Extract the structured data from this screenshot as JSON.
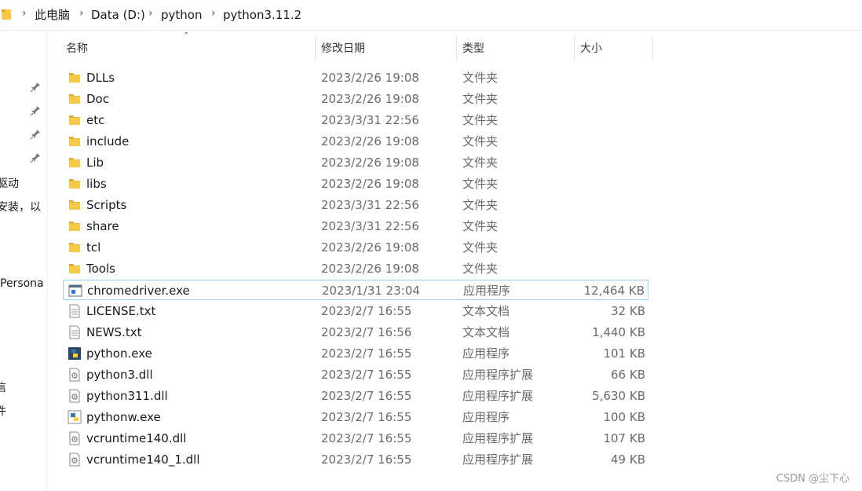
{
  "breadcrumb": {
    "parts": [
      "此电脑",
      "Data (D:)",
      "python",
      "python3.11.2"
    ],
    "separator": ">"
  },
  "nav_fragments": [
    "驱动",
    "安装，以",
    "Persona",
    "信",
    "件"
  ],
  "columns": {
    "name": "名称",
    "date": "修改日期",
    "type": "类型",
    "size": "大小"
  },
  "files": [
    {
      "name": "DLLs",
      "date": "2023/2/26 19:08",
      "type": "文件夹",
      "size": "",
      "icon": "folder-icon"
    },
    {
      "name": "Doc",
      "date": "2023/2/26 19:08",
      "type": "文件夹",
      "size": "",
      "icon": "folder-icon"
    },
    {
      "name": "etc",
      "date": "2023/3/31 22:56",
      "type": "文件夹",
      "size": "",
      "icon": "folder-icon"
    },
    {
      "name": "include",
      "date": "2023/2/26 19:08",
      "type": "文件夹",
      "size": "",
      "icon": "folder-icon"
    },
    {
      "name": "Lib",
      "date": "2023/2/26 19:08",
      "type": "文件夹",
      "size": "",
      "icon": "folder-icon"
    },
    {
      "name": "libs",
      "date": "2023/2/26 19:08",
      "type": "文件夹",
      "size": "",
      "icon": "folder-icon"
    },
    {
      "name": "Scripts",
      "date": "2023/3/31 22:56",
      "type": "文件夹",
      "size": "",
      "icon": "folder-icon"
    },
    {
      "name": "share",
      "date": "2023/3/31 22:56",
      "type": "文件夹",
      "size": "",
      "icon": "folder-icon"
    },
    {
      "name": "tcl",
      "date": "2023/2/26 19:08",
      "type": "文件夹",
      "size": "",
      "icon": "folder-icon"
    },
    {
      "name": "Tools",
      "date": "2023/2/26 19:08",
      "type": "文件夹",
      "size": "",
      "icon": "folder-icon"
    },
    {
      "name": "chromedriver.exe",
      "date": "2023/1/31 23:04",
      "type": "应用程序",
      "size": "12,464 KB",
      "icon": "exe-icon",
      "selected": true
    },
    {
      "name": "LICENSE.txt",
      "date": "2023/2/7 16:55",
      "type": "文本文档",
      "size": "32 KB",
      "icon": "text-file-icon"
    },
    {
      "name": "NEWS.txt",
      "date": "2023/2/7 16:56",
      "type": "文本文档",
      "size": "1,440 KB",
      "icon": "text-file-icon"
    },
    {
      "name": "python.exe",
      "date": "2023/2/7 16:55",
      "type": "应用程序",
      "size": "101 KB",
      "icon": "python-icon"
    },
    {
      "name": "python3.dll",
      "date": "2023/2/7 16:55",
      "type": "应用程序扩展",
      "size": "66 KB",
      "icon": "dll-icon"
    },
    {
      "name": "python311.dll",
      "date": "2023/2/7 16:55",
      "type": "应用程序扩展",
      "size": "5,630 KB",
      "icon": "dll-icon"
    },
    {
      "name": "pythonw.exe",
      "date": "2023/2/7 16:55",
      "type": "应用程序",
      "size": "100 KB",
      "icon": "pythonw-icon"
    },
    {
      "name": "vcruntime140.dll",
      "date": "2023/2/7 16:55",
      "type": "应用程序扩展",
      "size": "107 KB",
      "icon": "dll-icon"
    },
    {
      "name": "vcruntime140_1.dll",
      "date": "2023/2/7 16:55",
      "type": "应用程序扩展",
      "size": "49 KB",
      "icon": "dll-icon"
    }
  ],
  "watermark": "CSDN @尘下心",
  "colors": {
    "folder": "#f7c948",
    "selection_border": "#99d1ff",
    "secondary_text": "#6b6b6b"
  }
}
